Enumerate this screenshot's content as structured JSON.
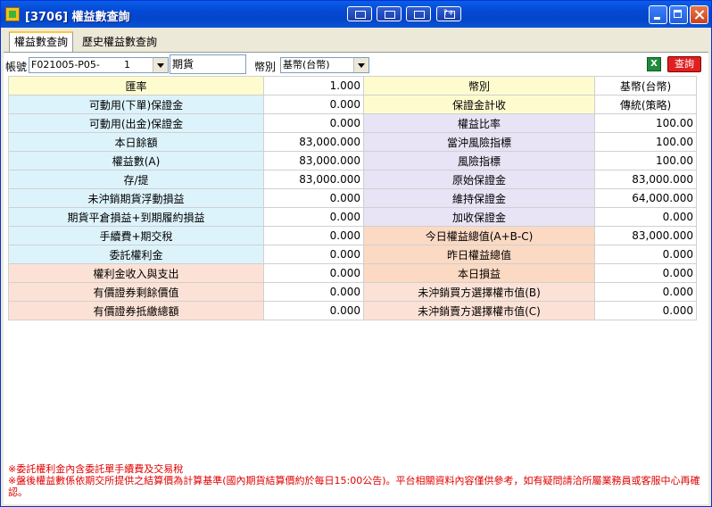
{
  "window": {
    "title": "[3706] 權益數查詢",
    "toolbar_icons": [
      "layout-icon",
      "window-icon",
      "window-close-icon",
      "help-icon"
    ],
    "help_label": "?+"
  },
  "tabs": [
    {
      "label": "權益數查詢",
      "active": true
    },
    {
      "label": "歷史權益數查詢",
      "active": false
    }
  ],
  "filters": {
    "account_label": "帳號",
    "account_value": "F021005-P05-",
    "account_suffix": "1",
    "product_value": "期貨",
    "currency_label": "幣別",
    "currency_value": "基幣(台幣)",
    "excel_label": "X",
    "query_label": "查詢"
  },
  "table": {
    "rows": [
      [
        {
          "t": "匯率",
          "c": "yellow"
        },
        {
          "t": "1.000",
          "c": "white"
        },
        {
          "t": "幣別",
          "c": "yellow"
        },
        {
          "t": "基幣(台幣)",
          "c": "white"
        }
      ],
      [
        {
          "t": "可動用(下單)保證金",
          "c": "blue"
        },
        {
          "t": "0.000",
          "c": "white"
        },
        {
          "t": "保證金計收",
          "c": "yellow"
        },
        {
          "t": "傳統(策略)",
          "c": "white"
        }
      ],
      [
        {
          "t": "可動用(出金)保證金",
          "c": "blue"
        },
        {
          "t": "0.000",
          "c": "white"
        },
        {
          "t": "權益比率",
          "c": "lav"
        },
        {
          "t": "100.00",
          "c": "white"
        }
      ],
      [
        {
          "t": "本日餘額",
          "c": "blue"
        },
        {
          "t": "83,000.000",
          "c": "white"
        },
        {
          "t": "當沖風險指標",
          "c": "lav"
        },
        {
          "t": "100.00",
          "c": "white"
        }
      ],
      [
        {
          "t": "權益數(A)",
          "c": "blue"
        },
        {
          "t": "83,000.000",
          "c": "white"
        },
        {
          "t": "風險指標",
          "c": "lav"
        },
        {
          "t": "100.00",
          "c": "white"
        }
      ],
      [
        {
          "t": "存/提",
          "c": "blue"
        },
        {
          "t": "83,000.000",
          "c": "white"
        },
        {
          "t": "原始保證金",
          "c": "lav"
        },
        {
          "t": "83,000.000",
          "c": "white"
        }
      ],
      [
        {
          "t": "未沖銷期貨浮動損益",
          "c": "blue"
        },
        {
          "t": "0.000",
          "c": "white"
        },
        {
          "t": "維持保證金",
          "c": "lav"
        },
        {
          "t": "64,000.000",
          "c": "white"
        }
      ],
      [
        {
          "t": "期貨平倉損益+到期履約損益",
          "c": "blue"
        },
        {
          "t": "0.000",
          "c": "white"
        },
        {
          "t": "加收保證金",
          "c": "lav"
        },
        {
          "t": "0.000",
          "c": "white"
        }
      ],
      [
        {
          "t": "手續費+期交稅",
          "c": "blue"
        },
        {
          "t": "0.000",
          "c": "white"
        },
        {
          "t": "今日權益總值(A+B-C)",
          "c": "peach"
        },
        {
          "t": "83,000.000",
          "c": "white"
        }
      ],
      [
        {
          "t": "委託權利金",
          "c": "blue"
        },
        {
          "t": "0.000",
          "c": "white"
        },
        {
          "t": "昨日權益總值",
          "c": "peach"
        },
        {
          "t": "0.000",
          "c": "white"
        }
      ],
      [
        {
          "t": "權利金收入與支出",
          "c": "pink"
        },
        {
          "t": "0.000",
          "c": "white"
        },
        {
          "t": "本日損益",
          "c": "peach"
        },
        {
          "t": "0.000",
          "c": "white"
        }
      ],
      [
        {
          "t": "有價證券剩餘價值",
          "c": "pink"
        },
        {
          "t": "0.000",
          "c": "white"
        },
        {
          "t": "未沖銷買方選擇權市值(B)",
          "c": "pink"
        },
        {
          "t": "0.000",
          "c": "white"
        }
      ],
      [
        {
          "t": "有價證券抵繳總額",
          "c": "pink"
        },
        {
          "t": "0.000",
          "c": "white"
        },
        {
          "t": "未沖銷賣方選擇權市值(C)",
          "c": "pink"
        },
        {
          "t": "0.000",
          "c": "white"
        }
      ]
    ]
  },
  "footer": {
    "line1": "※委託權利金內含委託單手續費及交易稅",
    "line2": "※盤後權益數係依期交所提供之結算價為計算基準(國內期貨結算價約於每日15:00公告)。平台相關資料內容僅供參考，如有疑問請洽所屬業務員或客服中心再確認。"
  }
}
